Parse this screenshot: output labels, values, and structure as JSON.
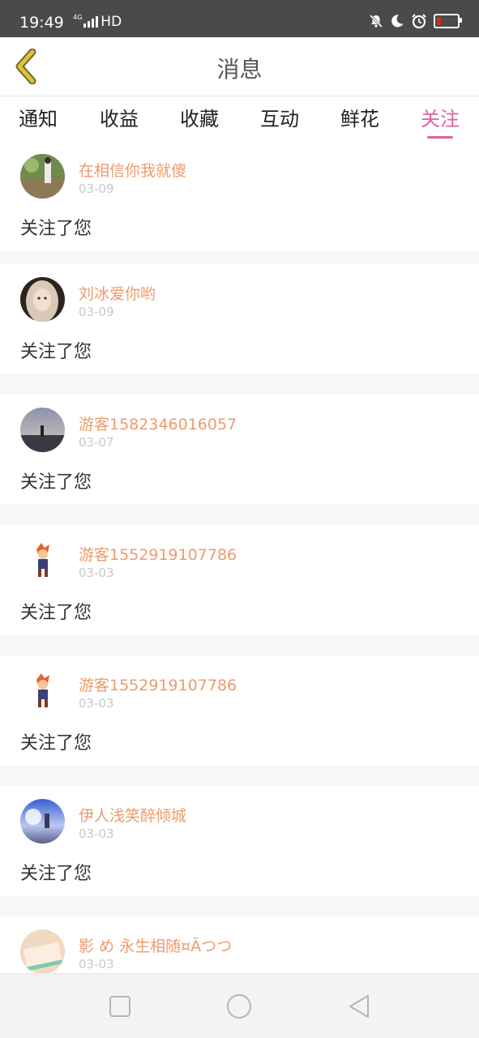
{
  "status_bar": {
    "time": "19:49",
    "network_small": "4G",
    "network": "HD",
    "icons": [
      "mute-icon",
      "moon-icon",
      "alarm-icon",
      "battery-icon"
    ]
  },
  "header": {
    "title": "消息",
    "back_icon": "chevron-left-icon"
  },
  "tabs": [
    {
      "label": "通知"
    },
    {
      "label": "收益"
    },
    {
      "label": "收藏"
    },
    {
      "label": "互动"
    },
    {
      "label": "鲜花"
    },
    {
      "label": "关注",
      "active": true
    }
  ],
  "messages": [
    {
      "name": "在相信你我就傻",
      "date": "03-09",
      "text": "关注了您"
    },
    {
      "name": "刘冰爱你哟",
      "date": "03-09",
      "text": "关注了您"
    },
    {
      "name": "游客1582346016057",
      "date": "03-07",
      "text": "关注了您"
    },
    {
      "name": "游客1552919107786",
      "date": "03-03",
      "text": "关注了您"
    },
    {
      "name": "游客1552919107786",
      "date": "03-03",
      "text": "关注了您"
    },
    {
      "name": "伊人浅笑醉倾城",
      "date": "03-03",
      "text": "关注了您"
    },
    {
      "name": "影 め 永生相随¤Ãつつ",
      "date": "03-03",
      "text": ""
    }
  ],
  "nav_bar": {
    "icons": [
      "square-icon",
      "circle-icon",
      "triangle-back-icon"
    ]
  },
  "colors": {
    "accent": "#e25f9c",
    "name": "#ee9b6c",
    "back": "#e6c12f"
  }
}
